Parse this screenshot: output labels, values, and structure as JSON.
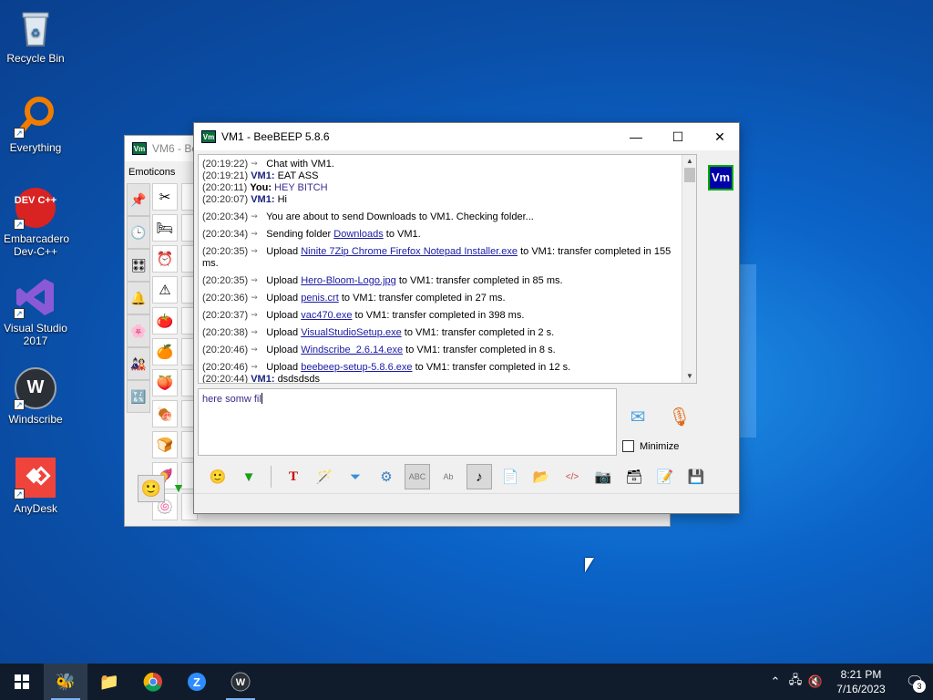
{
  "desktop": {
    "icons": [
      {
        "label": "Recycle Bin",
        "icon": "recycle-bin-icon"
      },
      {
        "label": "Everything",
        "icon": "magnifier-icon"
      },
      {
        "label": "Embarcadero Dev-C++",
        "icon": "devcpp-icon",
        "badge": "DEV C++"
      },
      {
        "label": "Visual Studio 2017",
        "icon": "visual-studio-icon"
      },
      {
        "label": "Windscribe",
        "icon": "windscribe-icon",
        "badge": "W"
      },
      {
        "label": "AnyDesk",
        "icon": "anydesk-icon"
      }
    ]
  },
  "back_window": {
    "title": "VM6 - Be",
    "emoticons_label": "Emoticons",
    "logo": "Vm"
  },
  "main_window": {
    "title": "VM1 - BeeBEEP 5.8.6",
    "logo": "Vm",
    "controls": {
      "minimize": "—",
      "maximize": "☐",
      "close": "✕"
    },
    "chat": [
      {
        "ts": "(20:19:22)",
        "kind": "sys",
        "text": "Chat with VM1."
      },
      {
        "ts": "(20:19:21)",
        "kind": "msg",
        "nick": "VM1:",
        "text": "EAT ASS"
      },
      {
        "ts": "(20:20:11)",
        "kind": "you",
        "nick": "You:",
        "text": "HEY BITCH"
      },
      {
        "ts": "(20:20:07)",
        "kind": "msg",
        "nick": "VM1:",
        "text": "Hi"
      },
      {
        "ts": "(20:20:34)",
        "kind": "sys",
        "text": "You are about to send Downloads to VM1. Checking folder..."
      },
      {
        "ts": "(20:20:34)",
        "kind": "sys-link",
        "pre": "Sending folder",
        "link": "Downloads",
        "post": "to VM1."
      },
      {
        "ts": "(20:20:35)",
        "kind": "upload",
        "pre": "Upload",
        "link": "Ninite 7Zip Chrome Firefox Notepad Installer.exe",
        "post": "to VM1: transfer completed in 155 ms."
      },
      {
        "ts": "(20:20:35)",
        "kind": "upload",
        "pre": "Upload",
        "link": "Hero-Bloom-Logo.jpg",
        "post": "to VM1: transfer completed in 85 ms."
      },
      {
        "ts": "(20:20:36)",
        "kind": "upload",
        "pre": "Upload",
        "link": "penis.crt",
        "post": "to VM1: transfer completed in 27 ms."
      },
      {
        "ts": "(20:20:37)",
        "kind": "upload",
        "pre": "Upload",
        "link": "vac470.exe",
        "post": "to VM1: transfer completed in 398 ms."
      },
      {
        "ts": "(20:20:38)",
        "kind": "upload",
        "pre": "Upload",
        "link": "VisualStudioSetup.exe",
        "post": "to VM1: transfer completed in 2 s."
      },
      {
        "ts": "(20:20:46)",
        "kind": "upload",
        "pre": "Upload",
        "link": "Windscribe_2.6.14.exe",
        "post": "to VM1: transfer completed in 8 s."
      },
      {
        "ts": "(20:20:46)",
        "kind": "upload",
        "pre": "Upload",
        "link": "beebeep-setup-5.8.6.exe",
        "post": "to VM1: transfer completed in 12 s."
      },
      {
        "ts": "(20:20:44)",
        "kind": "msg",
        "nick": "VM1:",
        "text": "dsdsdsds"
      }
    ],
    "input_value": "here somw fil",
    "minimize_label": "Minimize"
  },
  "taskbar": {
    "time": "8:21 PM",
    "date": "7/16/2023",
    "notification_count": "3"
  }
}
